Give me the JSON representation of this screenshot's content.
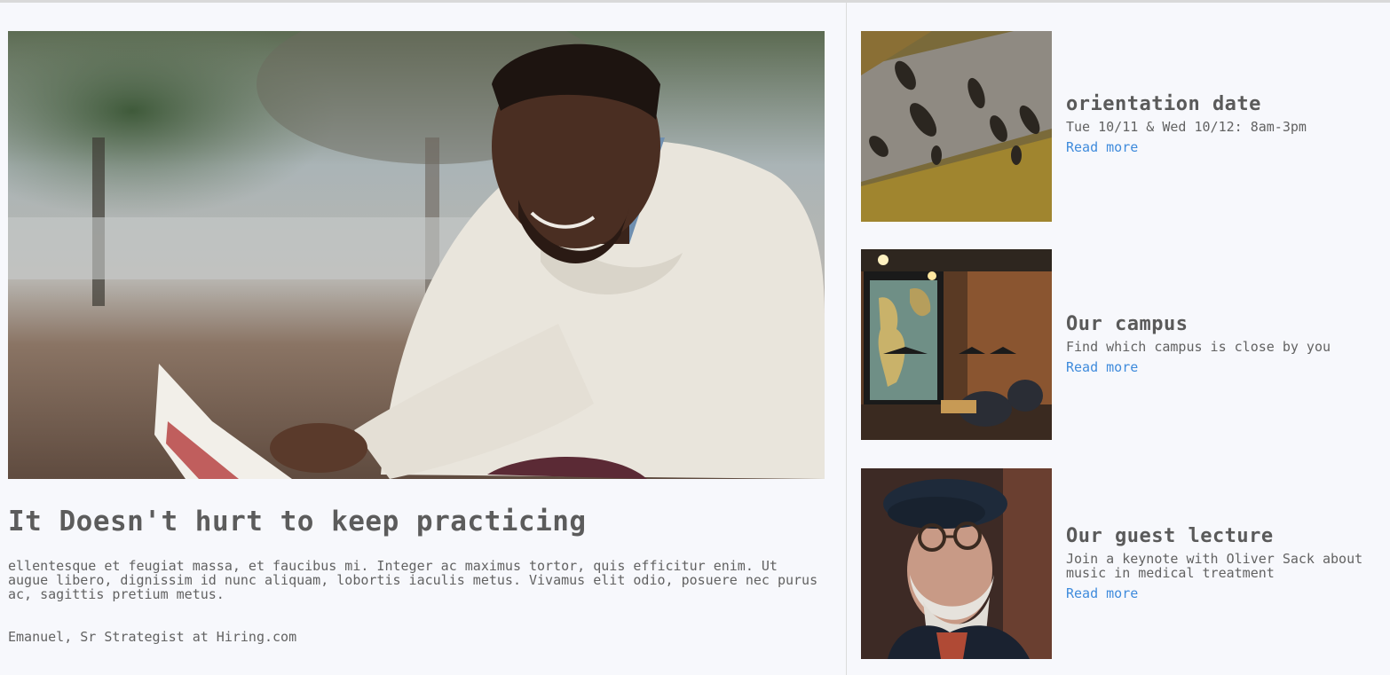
{
  "feature": {
    "image_alt": "man reading a book outdoors",
    "title": "It Doesn't hurt to keep practicing",
    "body": "ellentesque et feugiat massa, et faucibus mi. Integer ac maximus tortor, quis efficitur enim. Ut augue libero, dignissim id nunc aliquam, lobortis iaculis metus. Vivamus elit odio, posuere nec purus ac, sagittis pretium metus.",
    "byline": "Emanuel, Sr Strategist at Hiring.com"
  },
  "cards": [
    {
      "image_alt": "aerial view of people walking",
      "title": "orientation date",
      "description": "Tue 10/11 & Wed 10/12: 8am-3pm",
      "link": "Read more"
    },
    {
      "image_alt": "cafe interior with world map",
      "title": "Our campus",
      "description": "Find which campus is close by you",
      "link": "Read more"
    },
    {
      "image_alt": "older man with beret and glasses",
      "title": "Our guest lecture",
      "description": "Join a keynote with Oliver Sack about music in medical treatment",
      "link": "Read more"
    }
  ],
  "colors": {
    "background": "#f7f8fc",
    "text": "#5a5a5a",
    "link": "#3f8bdc"
  }
}
